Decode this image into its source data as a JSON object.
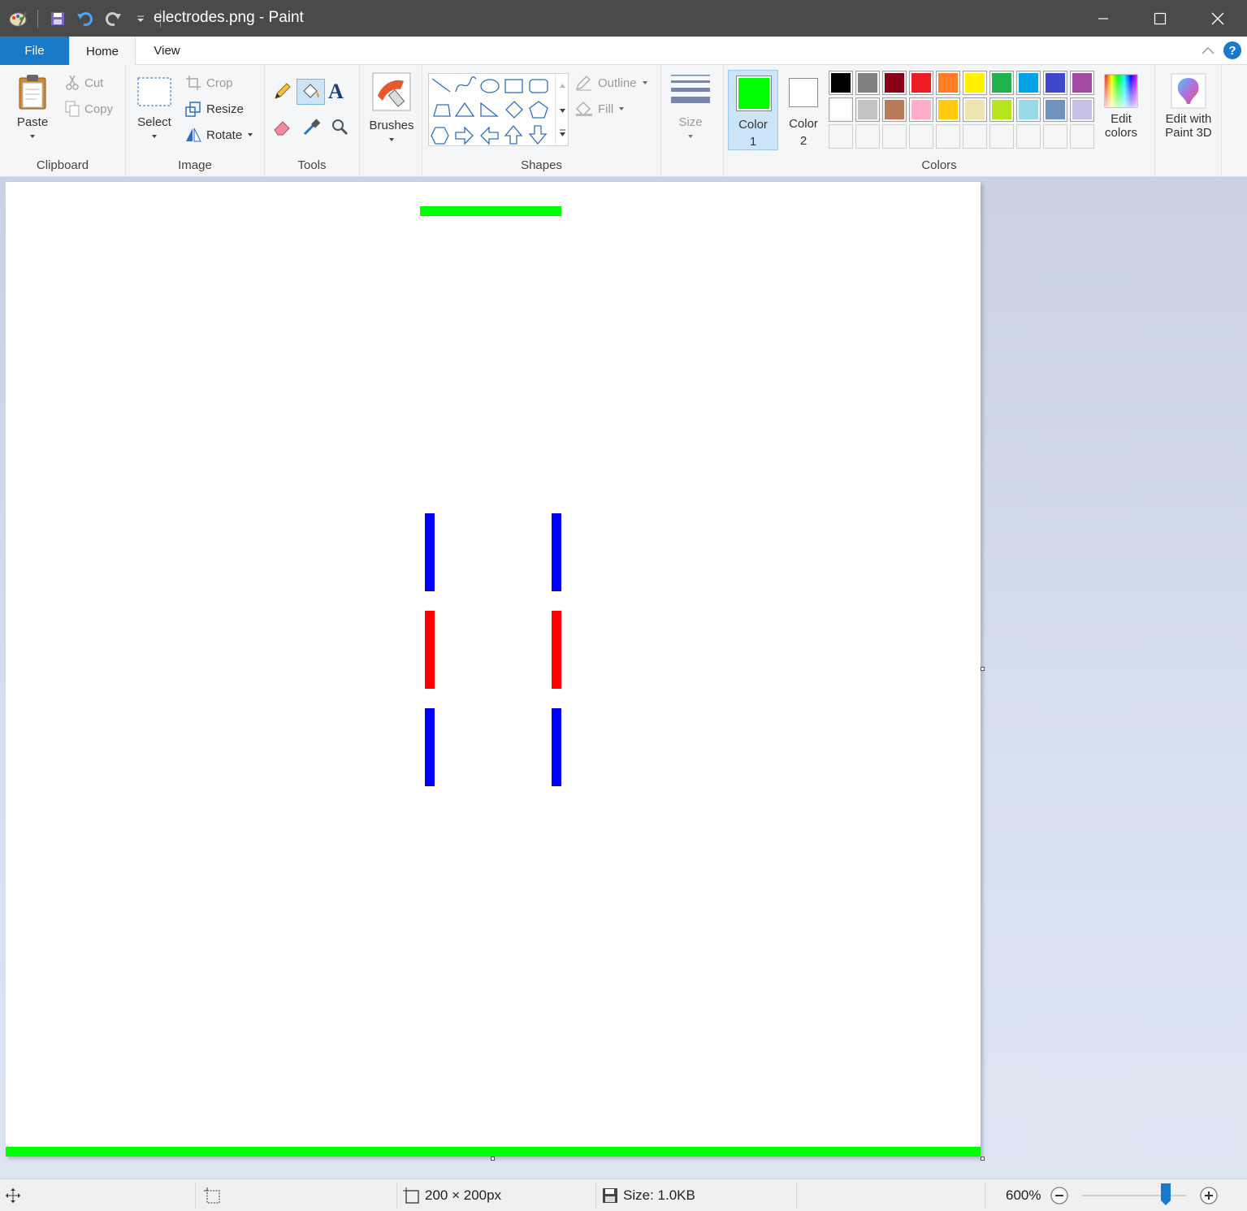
{
  "window": {
    "title": "electrodes.png - Paint"
  },
  "tabs": {
    "file": "File",
    "home": "Home",
    "view": "View"
  },
  "clipboard": {
    "paste": "Paste",
    "cut": "Cut",
    "copy": "Copy",
    "group": "Clipboard"
  },
  "image": {
    "select": "Select",
    "crop": "Crop",
    "resize": "Resize",
    "rotate": "Rotate",
    "group": "Image"
  },
  "tools": {
    "group": "Tools"
  },
  "brushes": {
    "label": "Brushes"
  },
  "shapes": {
    "outline": "Outline",
    "fill": "Fill",
    "group": "Shapes"
  },
  "size": {
    "label": "Size"
  },
  "colors": {
    "color1_line1": "Color",
    "color1_line2": "1",
    "color2_line1": "Color",
    "color2_line2": "2",
    "edit_line1": "Edit",
    "edit_line2": "colors",
    "group": "Colors",
    "color1_value": "#00ff00",
    "color2_value": "#ffffff",
    "palette_row1": [
      "#000000",
      "#7f7f7f",
      "#880015",
      "#ed1c24",
      "#ff7f27",
      "#fff200",
      "#22b14c",
      "#00a2e8",
      "#3f48cc",
      "#a349a4"
    ],
    "palette_row2": [
      "#ffffff",
      "#c3c3c3",
      "#b97a57",
      "#ffaec9",
      "#ffc90e",
      "#efe4b0",
      "#b5e61d",
      "#99d9ea",
      "#7092be",
      "#c8bfe7"
    ]
  },
  "paint3d": {
    "line1": "Edit with",
    "line2": "Paint 3D"
  },
  "canvas_colors": {
    "green": "#00ff00",
    "blue": "#0000ff",
    "red": "#ff0000"
  },
  "status": {
    "dimensions": "200 × 200px",
    "size": "Size: 1.0KB",
    "zoom": "600%"
  }
}
